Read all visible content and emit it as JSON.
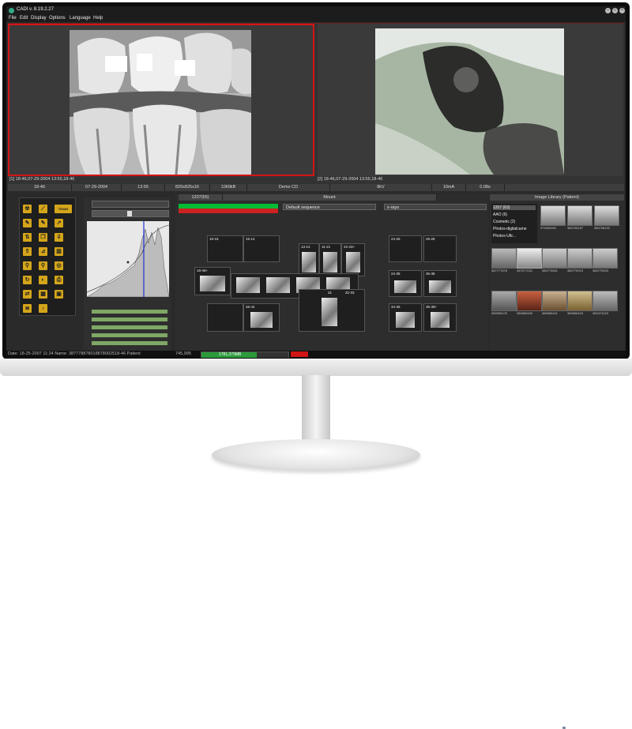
{
  "app": {
    "title": "CADI v. 8.19.2.27"
  },
  "menu": [
    "File",
    "Edit",
    "Display",
    "Options",
    "Language",
    "Help"
  ],
  "viewer": {
    "left_caption": "[1] 18-46,07-29-2004 13:55,18-46",
    "right_caption": "[2] 18-46,07-29-2004 13:55,18-46"
  },
  "status": [
    "18-46",
    "07-29-2004",
    "13:55",
    "820x825x16",
    "1069kB",
    "Demo CD",
    "8kV",
    "10mA",
    "0.08s"
  ],
  "tools": [
    "radiation-icon",
    "brush-icon",
    "train-icon",
    "pencil-icon",
    "pencil2-icon",
    "arrow-icon",
    "flip-icon",
    "copy-icon",
    "download-icon",
    "upload-icon",
    "measure-icon",
    "trash-icon",
    "zoom-icon",
    "zoom2-icon",
    "target-icon",
    "rotate-icon",
    "contrast-icon",
    "print-icon",
    "compare-icon",
    "calendar-icon",
    "save-icon",
    "stack-icon",
    "sound-icon"
  ],
  "tool_text": {
    "train": "TRAIN"
  },
  "mount": {
    "tabs": [
      "1207(55)",
      "Mount"
    ],
    "sequence_select": "Default sequence",
    "type_select": "x-rays",
    "slots": [
      "18-16",
      "15-14",
      "13-12",
      "11-21",
      "22-23+",
      "24-25",
      "26-28",
      "18-46+",
      "46-44",
      "31",
      "32-33",
      "24-36",
      "35-38",
      "34-36",
      "35-38+"
    ]
  },
  "library": {
    "header": "Image Library (Patient)",
    "list": [
      "1207 (63)",
      "AAO (6)",
      "Cosmetic (2)",
      "Photos-digitalcame",
      "Photos-Ultr..."
    ],
    "numbers": [
      "379405002",
      "380705157",
      "380708192",
      "387777878",
      "387977022",
      "380775501",
      "380775913",
      "380775923",
      "389955476",
      "389965409",
      "389965421",
      "389965423",
      "389474023"
    ]
  },
  "footer": {
    "left": "Date: 18-25-2007 11:24  Name: 387778878018878002518-46  Patient",
    "count": "745,995",
    "progress": "1781,379MB"
  }
}
